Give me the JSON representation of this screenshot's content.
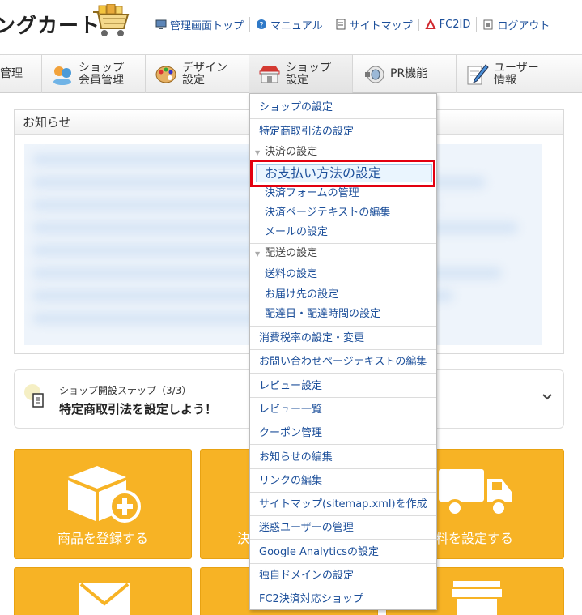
{
  "header": {
    "logo_text": "ングカート",
    "links": [
      {
        "label": "管理画面トップ",
        "icon": "monitor-icon"
      },
      {
        "label": "マニュアル",
        "icon": "help-icon"
      },
      {
        "label": "サイトマップ",
        "icon": "sitemap-icon"
      },
      {
        "label": "FC2ID",
        "icon": "fc2-icon"
      },
      {
        "label": "ログアウト",
        "icon": "logout-icon"
      }
    ]
  },
  "nav": {
    "items": [
      {
        "label": "管理",
        "icon": ""
      },
      {
        "label": "ショップ\n会員管理",
        "icon": "members-icon"
      },
      {
        "label": "デザイン\n設定",
        "icon": "palette-icon"
      },
      {
        "label": "ショップ\n設定",
        "icon": "shop-icon"
      },
      {
        "label": "PR機能",
        "icon": "megaphone-icon"
      },
      {
        "label": "ユーザー\n情報",
        "icon": "pen-icon"
      }
    ]
  },
  "notice": {
    "title": "お知らせ"
  },
  "step": {
    "subtitle": "ショップ開設ステップ（3/3）",
    "title": "特定商取引法を設定しよう！"
  },
  "tiles": [
    {
      "label": "商品を登録する",
      "icon": "box-plus-icon"
    },
    {
      "label": "決",
      "icon": ""
    },
    {
      "label": "料を設定する",
      "icon": "truck-icon"
    }
  ],
  "dropdown": {
    "shop_settings": "ショップの設定",
    "tokutei": "特定商取引法の設定",
    "payment_head": "決済の設定",
    "payment_items": [
      "お支払い方法の設定",
      "決済フォームの管理",
      "決済ページテキストの編集",
      "メールの設定"
    ],
    "delivery_head": "配送の設定",
    "delivery_items": [
      "送料の設定",
      "お届け先の設定",
      "配達日・配達時間の設定"
    ],
    "rest": [
      "消費税率の設定・変更",
      "お問い合わせページテキストの編集",
      "レビュー設定",
      "レビュー一覧",
      "クーポン管理",
      "お知らせの編集",
      "リンクの編集",
      "サイトマップ(sitemap.xml)を作成",
      "迷惑ユーザーの管理",
      "Google Analyticsの設定",
      "独自ドメインの設定",
      "FC2決済対応ショップ"
    ]
  },
  "colors": {
    "link": "#1c4f9a",
    "tile": "#f7b325",
    "highlight": "#e3000f"
  }
}
